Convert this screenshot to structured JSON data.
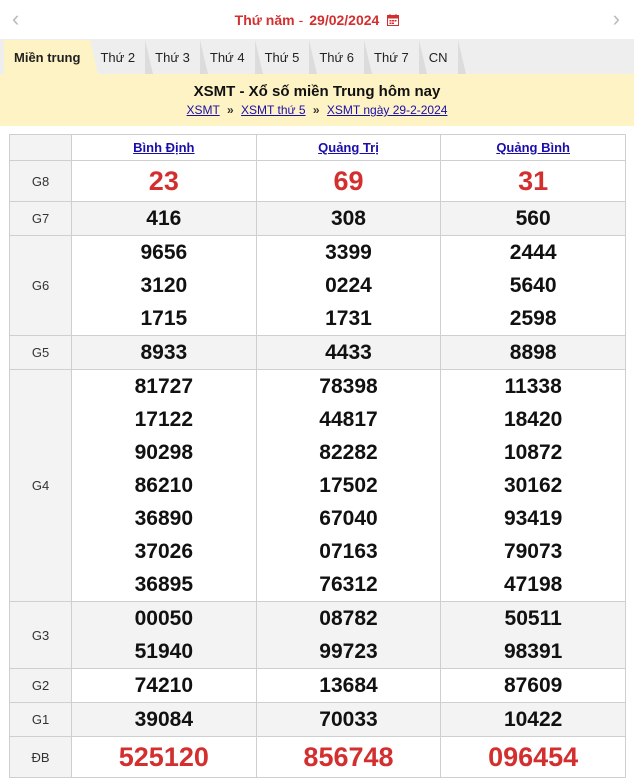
{
  "datebar": {
    "day": "Thứ năm",
    "separator": "-",
    "date": "29/02/2024"
  },
  "icons": {
    "prev": "chevron-left-icon",
    "next": "chevron-right-icon",
    "calendar": "calendar-icon"
  },
  "colors": {
    "accent_red": "#d32f2f",
    "header_bg": "#fdf3c4",
    "link_blue": "#1a0dab"
  },
  "tabs": [
    "Miền trung",
    "Thứ 2",
    "Thứ 3",
    "Thứ 4",
    "Thứ 5",
    "Thứ 6",
    "Thứ 7",
    "CN"
  ],
  "header": {
    "title": "XSMT - Xổ số miền Trung hôm nay",
    "crumbs": [
      "XSMT",
      "XSMT thứ 5",
      "XSMT ngày 29-2-2024"
    ],
    "crumb_sep": "»"
  },
  "table": {
    "provinces": [
      "Bình Định",
      "Quảng Trị",
      "Quảng Bình"
    ],
    "rows": [
      {
        "prize": "G8",
        "values": [
          [
            "23"
          ],
          [
            "69"
          ],
          [
            "31"
          ]
        ]
      },
      {
        "prize": "G7",
        "values": [
          [
            "416"
          ],
          [
            "308"
          ],
          [
            "560"
          ]
        ]
      },
      {
        "prize": "G6",
        "values": [
          [
            "9656",
            "3120",
            "1715"
          ],
          [
            "3399",
            "0224",
            "1731"
          ],
          [
            "2444",
            "5640",
            "2598"
          ]
        ]
      },
      {
        "prize": "G5",
        "values": [
          [
            "8933"
          ],
          [
            "4433"
          ],
          [
            "8898"
          ]
        ]
      },
      {
        "prize": "G4",
        "values": [
          [
            "81727",
            "17122",
            "90298",
            "86210",
            "36890",
            "37026",
            "36895"
          ],
          [
            "78398",
            "44817",
            "82282",
            "17502",
            "67040",
            "07163",
            "76312"
          ],
          [
            "11338",
            "18420",
            "10872",
            "30162",
            "93419",
            "79073",
            "47198"
          ]
        ]
      },
      {
        "prize": "G3",
        "values": [
          [
            "00050",
            "51940"
          ],
          [
            "08782",
            "99723"
          ],
          [
            "50511",
            "98391"
          ]
        ]
      },
      {
        "prize": "G2",
        "values": [
          [
            "74210"
          ],
          [
            "13684"
          ],
          [
            "87609"
          ]
        ]
      },
      {
        "prize": "G1",
        "values": [
          [
            "39084"
          ],
          [
            "70033"
          ],
          [
            "10422"
          ]
        ]
      },
      {
        "prize": "ĐB",
        "values": [
          [
            "525120"
          ],
          [
            "856748"
          ],
          [
            "096454"
          ]
        ]
      }
    ]
  }
}
